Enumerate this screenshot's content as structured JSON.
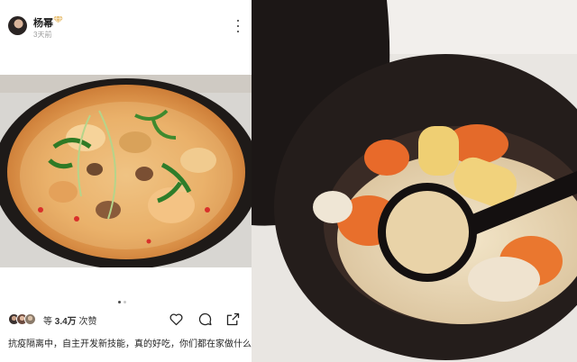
{
  "post": {
    "username": "杨幂",
    "time": "3天前",
    "likes_prefix": "等",
    "likes_count": "3.4万",
    "likes_suffix": "次赞",
    "caption": "抗疫隔离中，自主开发新技能，真的好吃，你们都在家做什么？",
    "carousel_index": 1,
    "carousel_total": 2
  },
  "colors": {
    "vip_badge": "#e9c37c",
    "active_dot": "#4a4a4a",
    "inactive_dot": "#c8c8c8"
  },
  "icons": [
    "gem-icon",
    "more-vertical-icon",
    "heart-icon",
    "comment-icon",
    "share-icon"
  ]
}
